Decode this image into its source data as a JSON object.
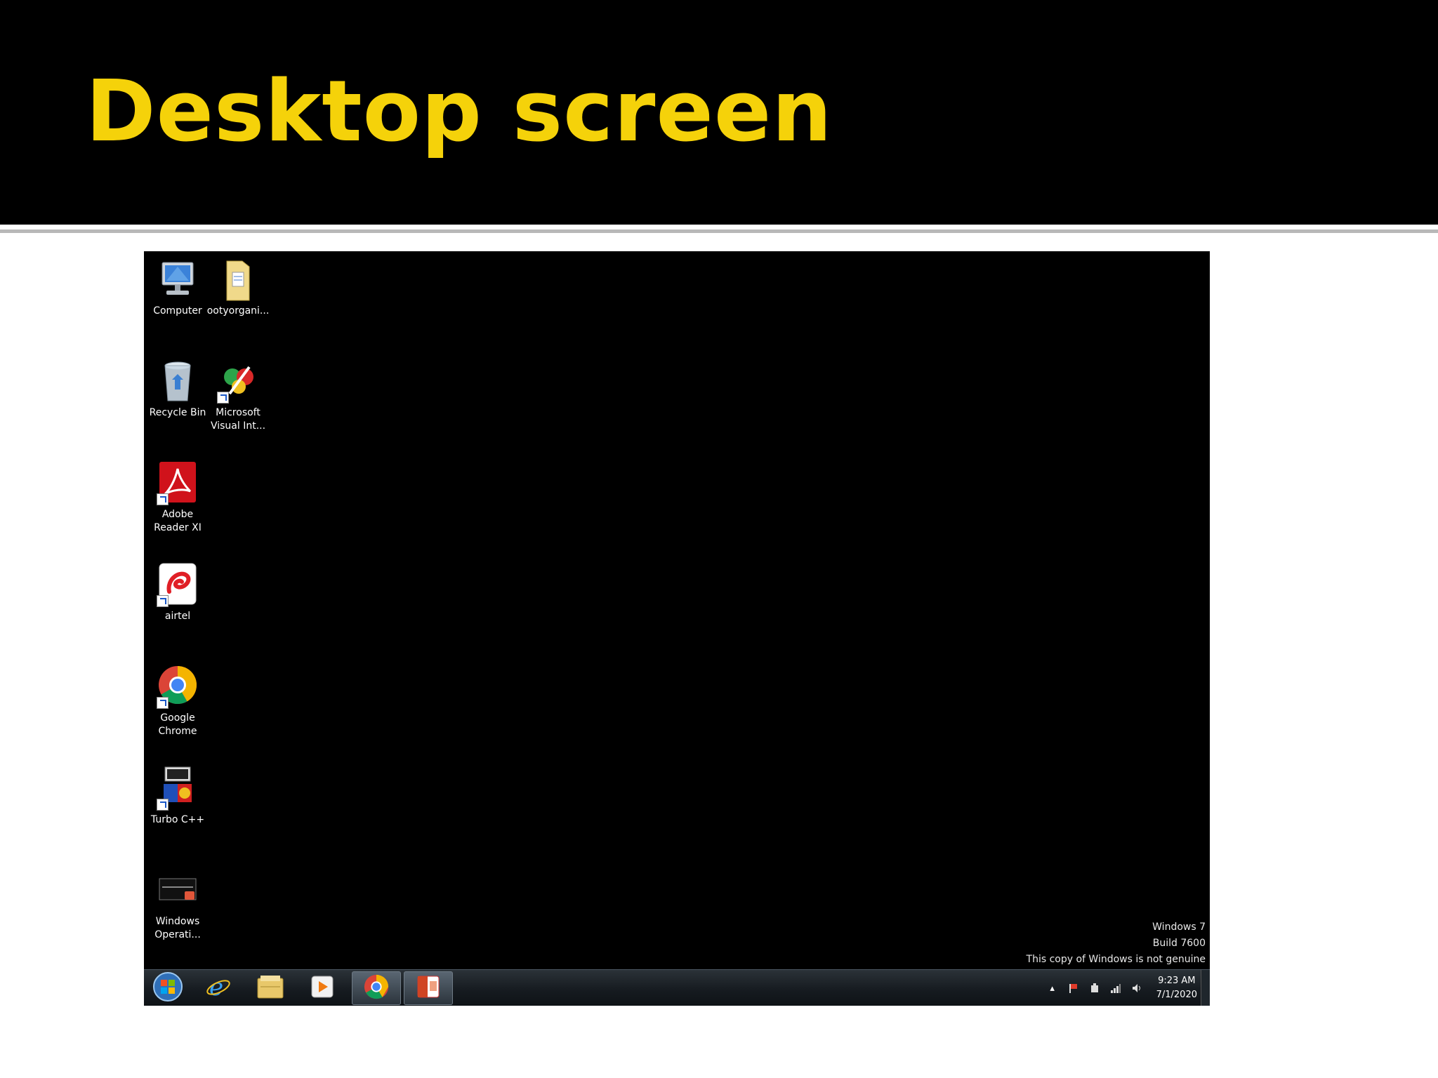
{
  "slide": {
    "title": "Desktop screen",
    "title_color": "#f5d20a"
  },
  "desktop": {
    "icons": [
      {
        "name": "computer",
        "icon": "computer-icon",
        "label": "Computer"
      },
      {
        "name": "folder",
        "icon": "folder-icon",
        "label": "ootyorgani..."
      },
      {
        "name": "recycle-bin",
        "icon": "recycle-bin-icon",
        "label": "Recycle Bin"
      },
      {
        "name": "microsoft-visual-int",
        "icon": "microsoft-visual-intercept-icon",
        "label": "Microsoft Visual Int..."
      },
      {
        "name": "adobe-reader",
        "icon": "adobe-reader-icon",
        "label": "Adobe Reader XI"
      },
      {
        "name": "airtel",
        "icon": "airtel-icon",
        "label": "airtel"
      },
      {
        "name": "google-chrome",
        "icon": "chrome-icon",
        "label": "Google Chrome"
      },
      {
        "name": "turbo-cpp",
        "icon": "turbo-cpp-icon",
        "label": "Turbo C++"
      },
      {
        "name": "windows-operati",
        "icon": "windows-operati-icon",
        "label": "Windows Operati..."
      }
    ],
    "watermark": {
      "line1": "Windows 7",
      "line2": "Build 7600",
      "line3": "This copy of Windows is not genuine"
    }
  },
  "taskbar": {
    "pinned": [
      {
        "name": "start-button",
        "icon": "windows-start-orb-icon"
      },
      {
        "name": "internet-explorer",
        "icon": "internet-explorer-icon"
      },
      {
        "name": "windows-explorer",
        "icon": "folder-libraries-icon"
      },
      {
        "name": "media-player",
        "icon": "media-player-icon"
      },
      {
        "name": "chrome",
        "icon": "chrome-icon",
        "active": true
      },
      {
        "name": "powerpoint",
        "icon": "powerpoint-icon",
        "active": true
      }
    ],
    "tray_icons": [
      "show-hidden-icons-icon",
      "action-center-flag-icon",
      "power-icon",
      "network-signal-icon",
      "volume-icon"
    ],
    "clock": {
      "time": "9:23 AM",
      "date": "7/1/2020"
    }
  }
}
